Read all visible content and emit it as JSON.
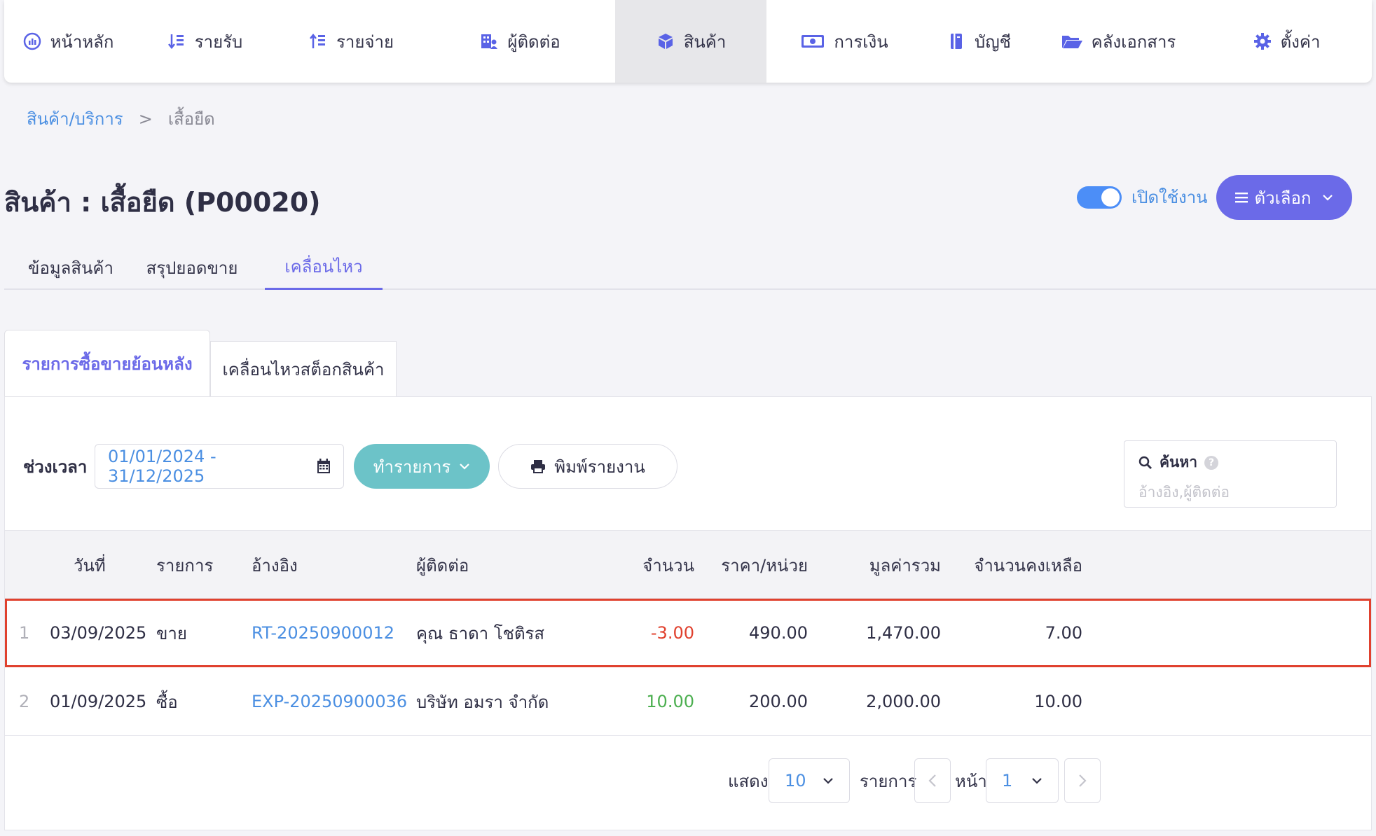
{
  "nav": {
    "items": [
      {
        "label": "หน้าหลัก",
        "icon": "dashboard-gauge-icon"
      },
      {
        "label": "รายรับ",
        "icon": "income-sort-icon"
      },
      {
        "label": "รายจ่าย",
        "icon": "expense-sort-icon"
      },
      {
        "label": "ผู้ติดต่อ",
        "icon": "contacts-building-icon"
      },
      {
        "label": "สินค้า",
        "icon": "product-box-icon"
      },
      {
        "label": "การเงิน",
        "icon": "money-icon"
      },
      {
        "label": "บัญชี",
        "icon": "ledger-book-icon"
      },
      {
        "label": "คลังเอกสาร",
        "icon": "folder-icon"
      },
      {
        "label": "ตั้งค่า",
        "icon": "gear-icon"
      }
    ],
    "active_index": 4,
    "accent_color": "#5a63e6"
  },
  "breadcrumb": {
    "parent": "สินค้า/บริการ",
    "separator": ">",
    "current": "เสื้อยืด"
  },
  "page": {
    "title": "สินค้า : เสื้อยืด (P00020)",
    "toggle_label": "เปิดใช้งาน",
    "toggle_on": true,
    "options_label": "ตัวเลือก"
  },
  "main_tabs": [
    {
      "label": "ข้อมูลสินค้า",
      "active": false
    },
    {
      "label": "สรุปยอดขาย",
      "active": false
    },
    {
      "label": "เคลื่อนไหว",
      "active": true
    }
  ],
  "sub_tabs": [
    {
      "label": "รายการซื้อขายย้อนหลัง",
      "active": true
    },
    {
      "label": "เคลื่อนไหวสต็อกสินค้า",
      "active": false
    }
  ],
  "filters": {
    "period_label": "ช่วงเวลา",
    "date_range": "01/01/2024 - 31/12/2025",
    "action_label": "ทำรายการ",
    "print_label": "พิมพ์รายงาน",
    "search_label": "ค้นหา",
    "search_placeholder": "อ้างอิง,ผู้ติดต่อ"
  },
  "table": {
    "columns": [
      "วันที่",
      "รายการ",
      "อ้างอิง",
      "ผู้ติดต่อ",
      "จำนวน",
      "ราคา/หน่วย",
      "มูลค่ารวม",
      "จำนวนคงเหลือ"
    ],
    "rows": [
      {
        "no": "1",
        "date": "03/09/2025",
        "type": "ขาย",
        "ref": "RT-20250900012",
        "contact": "คุณ ธาดา โชติรส",
        "qty": "-3.00",
        "unit_price": "490.00",
        "total": "1,470.00",
        "balance": "7.00",
        "highlighted": true
      },
      {
        "no": "2",
        "date": "01/09/2025",
        "type": "ซื้อ",
        "ref": "EXP-20250900036",
        "contact": "บริษัท อมรา จำกัด",
        "qty": "10.00",
        "unit_price": "200.00",
        "total": "2,000.00",
        "balance": "10.00",
        "highlighted": false
      }
    ]
  },
  "pagination": {
    "show_label": "แสดง",
    "page_size": "10",
    "items_label": "รายการ",
    "page_label": "หน้า",
    "page": "1"
  }
}
